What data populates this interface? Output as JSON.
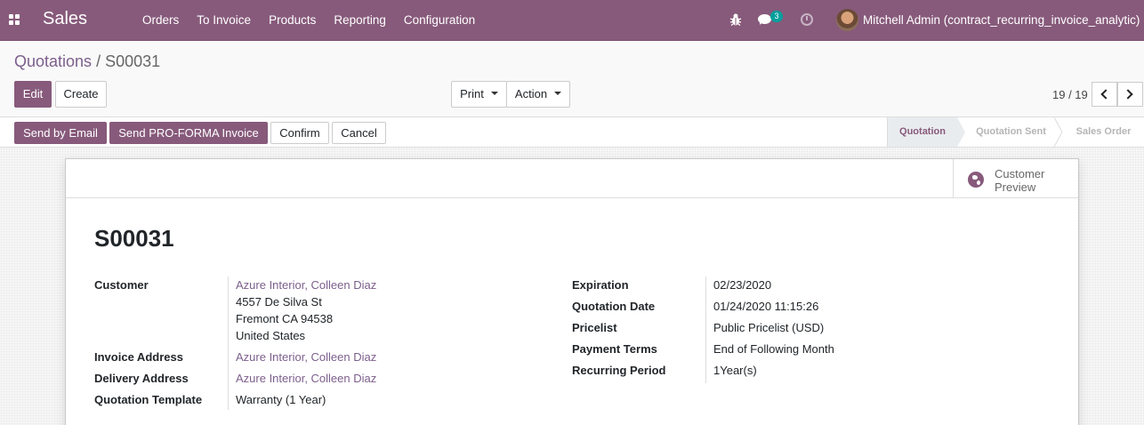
{
  "navbar": {
    "app_name": "Sales",
    "menu": [
      "Orders",
      "To Invoice",
      "Products",
      "Reporting",
      "Configuration"
    ],
    "message_count": "3",
    "user_name": "Mitchell Admin (contract_recurring_invoice_analytic)"
  },
  "breadcrumb": {
    "parent": "Quotations",
    "separator": "/",
    "current": "S00031"
  },
  "buttons": {
    "edit": "Edit",
    "create": "Create",
    "print": "Print",
    "action": "Action"
  },
  "pager": {
    "value": "19 / 19"
  },
  "statusbar": {
    "send_email": "Send by Email",
    "send_proforma": "Send PRO-FORMA Invoice",
    "confirm": "Confirm",
    "cancel": "Cancel",
    "stages": [
      "Quotation",
      "Quotation Sent",
      "Sales Order"
    ],
    "active_stage": "Quotation"
  },
  "sheet": {
    "customer_preview": "Customer Preview",
    "title": "S00031",
    "left_fields": {
      "customer_label": "Customer",
      "customer_name": "Azure Interior, Colleen Diaz",
      "customer_street": "4557 De Silva St",
      "customer_city": "Fremont CA 94538",
      "customer_country": "United States",
      "invoice_label": "Invoice Address",
      "invoice_value": "Azure Interior, Colleen Diaz",
      "delivery_label": "Delivery Address",
      "delivery_value": "Azure Interior, Colleen Diaz",
      "template_label": "Quotation Template",
      "template_value": "Warranty (1 Year)"
    },
    "right_fields": {
      "expiration_label": "Expiration",
      "expiration_value": "02/23/2020",
      "date_label": "Quotation Date",
      "date_value": "01/24/2020 11:15:26",
      "pricelist_label": "Pricelist",
      "pricelist_value": "Public Pricelist (USD)",
      "terms_label": "Payment Terms",
      "terms_value": "End of Following Month",
      "recurring_label": "Recurring Period",
      "recurring_value": "1Year(s)"
    }
  },
  "colors": {
    "brand": "#875a7b",
    "link": "#7c5f8c",
    "badge": "#00a09d"
  }
}
